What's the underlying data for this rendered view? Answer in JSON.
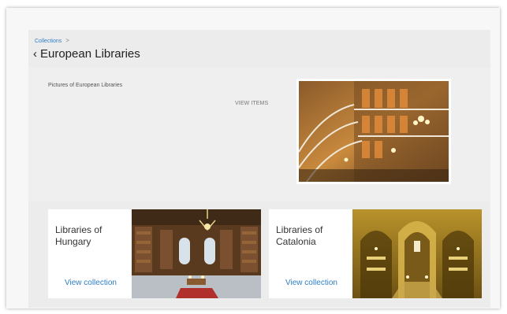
{
  "breadcrumb": {
    "collections": "Collections",
    "separator": ">"
  },
  "header": {
    "back_icon": "chevron-left-icon",
    "back_glyph": "‹",
    "title": "European Libraries"
  },
  "feature": {
    "description": "Pictures of European Libraries",
    "view_items_label": "VIEW ITEMS",
    "image": "library-spiral-staircase-photo"
  },
  "cards": [
    {
      "title": "Libraries of Hungary",
      "link_label": "View collection",
      "image": "hungary-library-photo"
    },
    {
      "title": "Libraries of Catalonia",
      "link_label": "View collection",
      "image": "catalonia-library-photo"
    }
  ],
  "colors": {
    "link": "#2f7fc6",
    "panel": "#ececec",
    "card": "#ffffff"
  }
}
